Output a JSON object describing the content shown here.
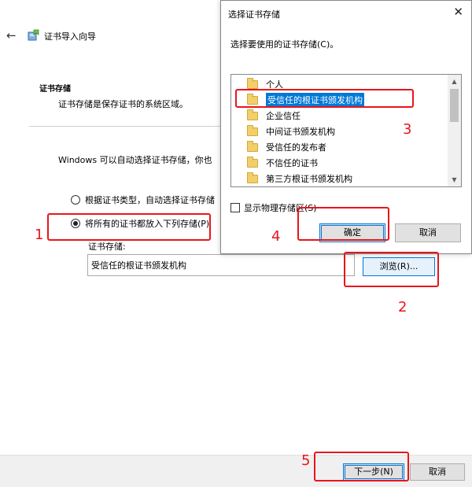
{
  "wizard": {
    "title": "证书导入向导",
    "section_title": "证书存储",
    "section_desc": "证书存储是保存证书的系统区域。",
    "auto_text": "Windows 可以自动选择证书存储，你也",
    "radio_auto_label": "根据证书类型，自动选择证书存储",
    "radio_manual_label": "将所有的证书都放入下列存储(P)",
    "radio_selected": "manual",
    "store_label": "证书存储:",
    "store_value": "受信任的根证书颁发机构",
    "browse_label": "浏览(R)...",
    "next_label": "下一步(N)",
    "cancel_label": "取消"
  },
  "dialog": {
    "title": "选择证书存储",
    "close_glyph": "✕",
    "prompt": "选择要使用的证书存储(C)。",
    "stores": [
      {
        "label": "个人",
        "selected": false
      },
      {
        "label": "受信任的根证书颁发机构",
        "selected": true
      },
      {
        "label": "企业信任",
        "selected": false
      },
      {
        "label": "中间证书颁发机构",
        "selected": false
      },
      {
        "label": "受信任的发布者",
        "selected": false
      },
      {
        "label": "不信任的证书",
        "selected": false
      },
      {
        "label": "第三方根证书颁发机构",
        "selected": false
      }
    ],
    "show_physical_label": "显示物理存储区(S)",
    "show_physical_checked": false,
    "ok_label": "确定",
    "cancel_label": "取消"
  },
  "annotations": {
    "step1": "1",
    "step2": "2",
    "step3": "3",
    "step4": "4",
    "step5": "5",
    "color": "#e8151b"
  },
  "icons": {
    "back": "back-arrow-icon",
    "wizard": "certificate-wizard-icon",
    "folder": "folder-icon",
    "close": "close-icon"
  }
}
